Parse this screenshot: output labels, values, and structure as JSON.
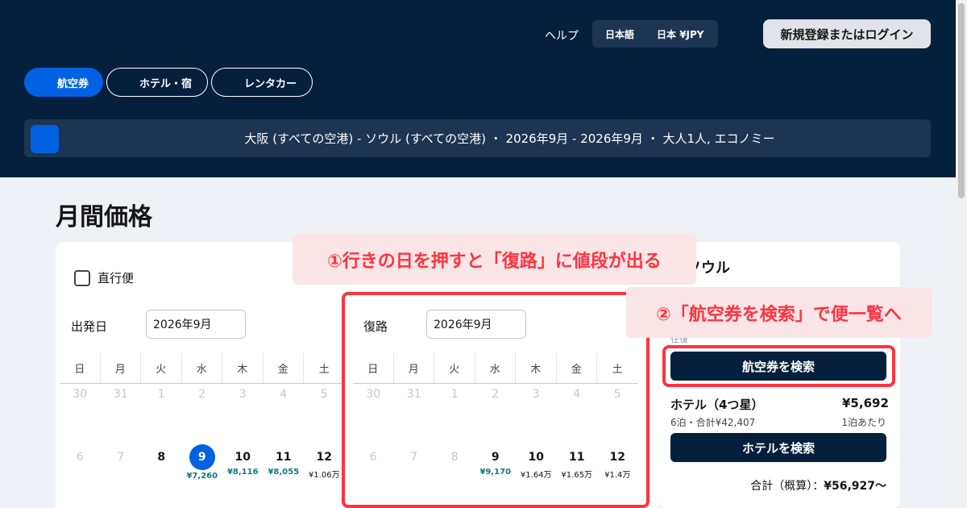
{
  "header": {
    "help": "ヘルプ",
    "language": "日本語",
    "region": "日本 ¥JPY",
    "login": "新規登録またはログイン",
    "colors": {
      "background": "#05203c",
      "accent": "#0062e3"
    }
  },
  "tabs": [
    {
      "label": "航空券",
      "icon": "plane-icon",
      "active": true
    },
    {
      "label": "ホテル・宿",
      "icon": "bed-icon",
      "active": false
    },
    {
      "label": "レンタカー",
      "icon": "car-icon",
      "active": false
    }
  ],
  "search_summary": "大阪 (すべての空港) - ソウル (すべての空港) ・ 2026年9月 - 2026年9月 ・ 大人1人, エコノミー",
  "page_title": "月間価格",
  "direct_only": "直行便",
  "outbound": {
    "label": "出発日",
    "month": "2026年9月",
    "weekdays": [
      "日",
      "月",
      "火",
      "水",
      "木",
      "金",
      "土"
    ],
    "rows": [
      [
        {
          "d": "30",
          "muted": true
        },
        {
          "d": "31",
          "muted": true
        },
        {
          "d": "1",
          "muted": true
        },
        {
          "d": "2",
          "muted": true
        },
        {
          "d": "3",
          "muted": true
        },
        {
          "d": "4",
          "muted": true
        },
        {
          "d": "5",
          "muted": true
        }
      ],
      [
        {
          "d": "6",
          "muted": true
        },
        {
          "d": "7",
          "muted": true
        },
        {
          "d": "8"
        },
        {
          "d": "9",
          "selected": true,
          "price": "¥7,260",
          "cheap": true
        },
        {
          "d": "10",
          "price": "¥8,116",
          "cheap": true
        },
        {
          "d": "11",
          "price": "¥8,055",
          "cheap": true
        },
        {
          "d": "12",
          "price": "¥1.06万"
        }
      ]
    ]
  },
  "inbound": {
    "label": "復路",
    "month": "2026年9月",
    "weekdays": [
      "日",
      "月",
      "火",
      "水",
      "木",
      "金",
      "土"
    ],
    "rows": [
      [
        {
          "d": "30",
          "muted": true
        },
        {
          "d": "31",
          "muted": true
        },
        {
          "d": "1",
          "muted": true
        },
        {
          "d": "2",
          "muted": true
        },
        {
          "d": "3",
          "muted": true
        },
        {
          "d": "4",
          "muted": true
        },
        {
          "d": "5",
          "muted": true
        }
      ],
      [
        {
          "d": "6",
          "muted": true
        },
        {
          "d": "7",
          "muted": true
        },
        {
          "d": "8",
          "muted": true
        },
        {
          "d": "9",
          "price": "¥9,170",
          "cheap": true
        },
        {
          "d": "10",
          "price": "¥1.64万"
        },
        {
          "d": "11",
          "price": "¥1.65万"
        },
        {
          "d": "12",
          "price": "¥1.4万"
        }
      ]
    ]
  },
  "annotations": {
    "note1": "①行きの日を押すと「復路」に値段が出る",
    "note2": "②「航空券を検索」で便一覧へ",
    "highlight_color": "#ff3340"
  },
  "sidebar": {
    "destination": "ソウル",
    "trip_type": "往復",
    "search_flights": "航空券を検索",
    "hotel_title": "ホテル（4つ星）",
    "hotel_price": "¥5,692",
    "hotel_sub": "6泊・合計¥42,407",
    "hotel_per": "1泊あたり",
    "search_hotels": "ホテルを検索",
    "total_label": "合計（概算）：",
    "total_value": "¥56,927〜"
  }
}
